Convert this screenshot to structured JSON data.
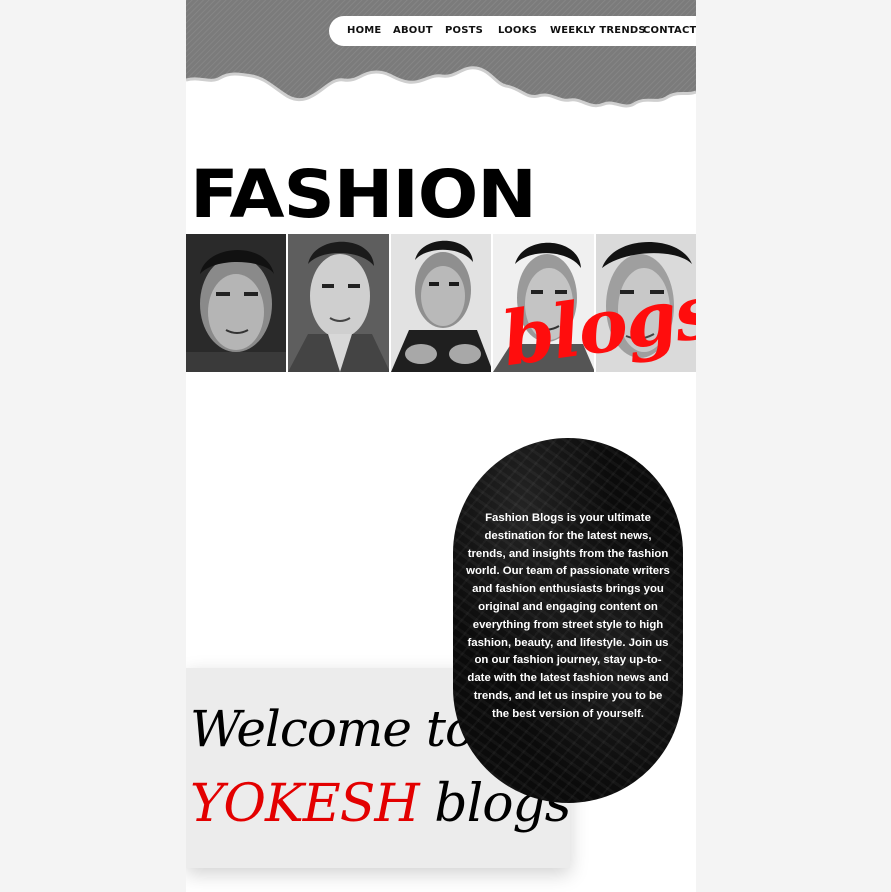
{
  "nav": {
    "items": [
      {
        "label": "HOME"
      },
      {
        "label": "ABOUT"
      },
      {
        "label": "POSTS"
      },
      {
        "label": "LOOKS"
      },
      {
        "label": "WEEKLY TRENDS"
      },
      {
        "label": "CONTACT"
      }
    ]
  },
  "hero": {
    "title": "FASHION",
    "subtitle": "blogs"
  },
  "about": {
    "text": "Fashion Blogs is your ultimate destination for the latest news, trends, and insights from the fashion world. Our team of passionate writers and fashion enthusiasts brings you original and engaging content on everything from street style to high fashion, beauty, and lifestyle. Join us on our fashion journey, stay up-to-date with the latest fashion news and trends, and let us inspire you to be the best version of yourself."
  },
  "welcome": {
    "line1": "Welcome to",
    "brand": "YOKESH",
    "rest": "blogs"
  },
  "colors": {
    "accent_red": "#ff0d0d",
    "header_grey": "#7f7f7f",
    "pill_black": "#0b0b0b",
    "card_grey": "#ececec"
  },
  "icons": {
    "portraits": [
      "portrait-1",
      "portrait-2",
      "portrait-3",
      "portrait-4",
      "portrait-5"
    ]
  }
}
